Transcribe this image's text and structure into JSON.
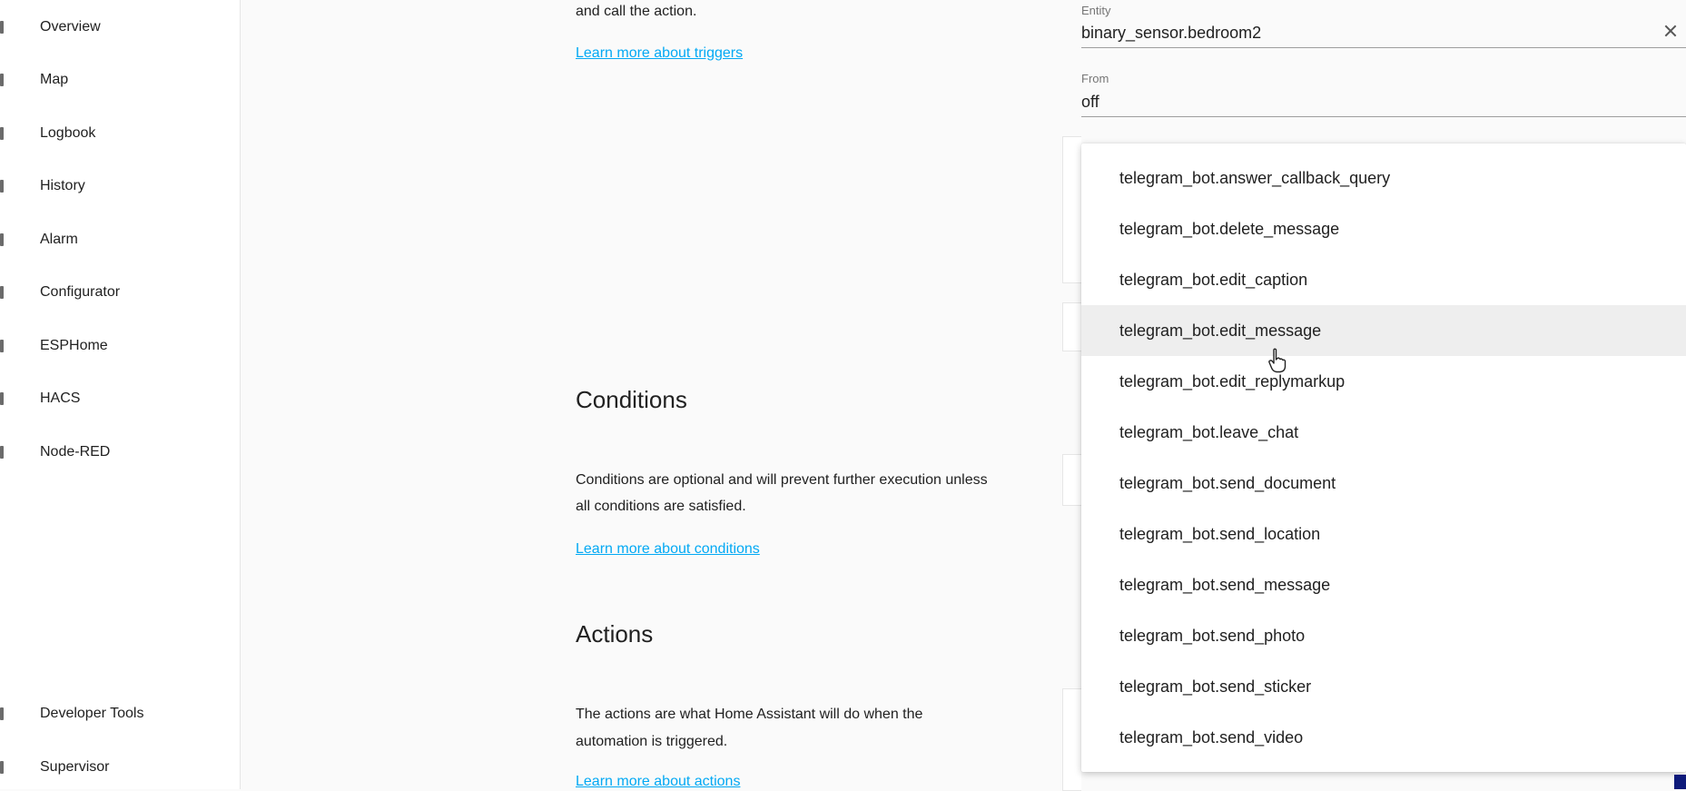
{
  "sidebar": {
    "items": [
      {
        "label": "Overview"
      },
      {
        "label": "Map"
      },
      {
        "label": "Logbook"
      },
      {
        "label": "History"
      },
      {
        "label": "Alarm"
      },
      {
        "label": "Configurator"
      },
      {
        "label": "ESPHome"
      },
      {
        "label": "HACS"
      },
      {
        "label": "Node-RED"
      }
    ],
    "bottom_items": [
      {
        "label": "Developer Tools"
      },
      {
        "label": "Supervisor"
      }
    ]
  },
  "triggers": {
    "text_tail": "and call the action.",
    "learn_more": "Learn more about triggers"
  },
  "conditions": {
    "title": "Conditions",
    "description_line1": "Conditions are optional and will prevent further execution unless",
    "description_line2": "all conditions are satisfied.",
    "learn_more": "Learn more about conditions"
  },
  "actions": {
    "title": "Actions",
    "description_line1": "The actions are what Home Assistant will do when the",
    "description_line2": "automation is triggered.",
    "learn_more": "Learn more about actions"
  },
  "trigger_form": {
    "entity_label": "Entity",
    "entity_value": "binary_sensor.bedroom2",
    "from_label": "From",
    "from_value": "off"
  },
  "dropdown": {
    "options": [
      "telegram_bot.answer_callback_query",
      "telegram_bot.delete_message",
      "telegram_bot.edit_caption",
      "telegram_bot.edit_message",
      "telegram_bot.edit_replymarkup",
      "telegram_bot.leave_chat",
      "telegram_bot.send_document",
      "telegram_bot.send_location",
      "telegram_bot.send_message",
      "telegram_bot.send_photo",
      "telegram_bot.send_sticker",
      "telegram_bot.send_video"
    ],
    "hovered": "telegram_bot.edit_message"
  },
  "colors": {
    "link": "#03a9f4",
    "hover_bg": "#eeeeee"
  }
}
